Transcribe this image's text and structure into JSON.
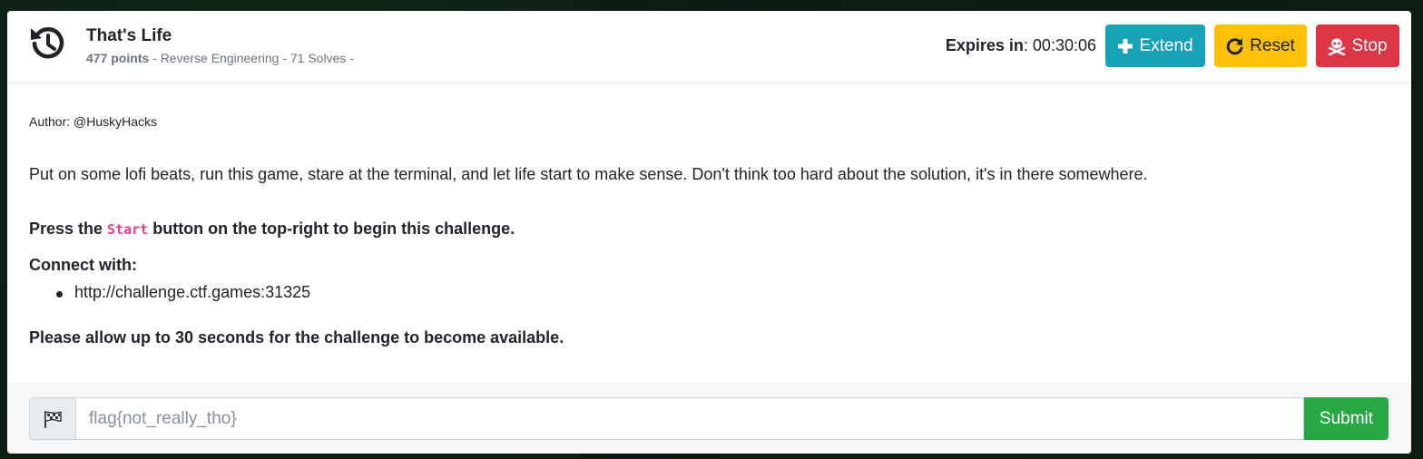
{
  "header": {
    "icon": "history-icon",
    "title": "That's Life",
    "points": "477 points",
    "meta": " - Reverse Engineering - 71 Solves -",
    "expires_label": "Expires in",
    "expires_value": ": 00:30:06",
    "buttons": {
      "extend": "Extend",
      "reset": "Reset",
      "stop": "Stop"
    }
  },
  "body": {
    "author": "Author: @HuskyHacks",
    "description": "Put on some lofi beats, run this game, stare at the terminal, and let life start to make sense. Don't think too hard about the solution, it's in there somewhere.",
    "press_prefix": "Press the ",
    "press_code": "Start",
    "press_suffix": " button on the top-right to begin this challenge.",
    "connect_label": "Connect with:",
    "connections": [
      "http://challenge.ctf.games:31325"
    ],
    "allow_note": "Please allow up to 30 seconds for the challenge to become available."
  },
  "footer": {
    "flag_placeholder": "flag{not_really_tho}",
    "submit_label": "Submit"
  },
  "colors": {
    "extend": "#17a2b8",
    "reset": "#ffc107",
    "stop": "#dc3545",
    "submit": "#28a745",
    "code": "#e83e8c"
  }
}
